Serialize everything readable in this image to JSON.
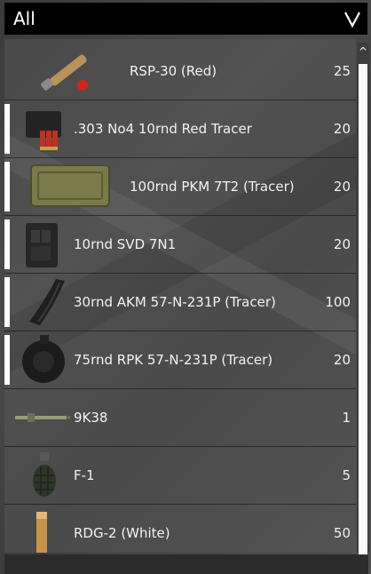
{
  "filter": {
    "selected": "All"
  },
  "items": [
    {
      "name": "RSP-30 (Red)",
      "qty": "25",
      "icon": "flare-icon",
      "selected": false
    },
    {
      "name": ".303 No4 10rnd Red Tracer",
      "qty": "20",
      "icon": "magazine-303-icon",
      "selected": true
    },
    {
      "name": "100rnd PKM 7T2 (Tracer)",
      "qty": "20",
      "icon": "ammo-box-icon",
      "selected": true
    },
    {
      "name": "10rnd SVD 7N1",
      "qty": "20",
      "icon": "svd-magazine-icon",
      "selected": true
    },
    {
      "name": "30rnd AKM 57-N-231P (Tracer)",
      "qty": "100",
      "icon": "akm-magazine-icon",
      "selected": true
    },
    {
      "name": "75rnd RPK 57-N-231P (Tracer)",
      "qty": "20",
      "icon": "drum-magazine-icon",
      "selected": true
    },
    {
      "name": "9K38",
      "qty": "1",
      "icon": "missile-icon",
      "selected": false
    },
    {
      "name": "F-1",
      "qty": "5",
      "icon": "grenade-icon",
      "selected": false
    },
    {
      "name": "RDG-2 (White)",
      "qty": "50",
      "icon": "smoke-grenade-icon",
      "selected": false
    }
  ],
  "scrollbar": {
    "up_glyph": "^"
  }
}
